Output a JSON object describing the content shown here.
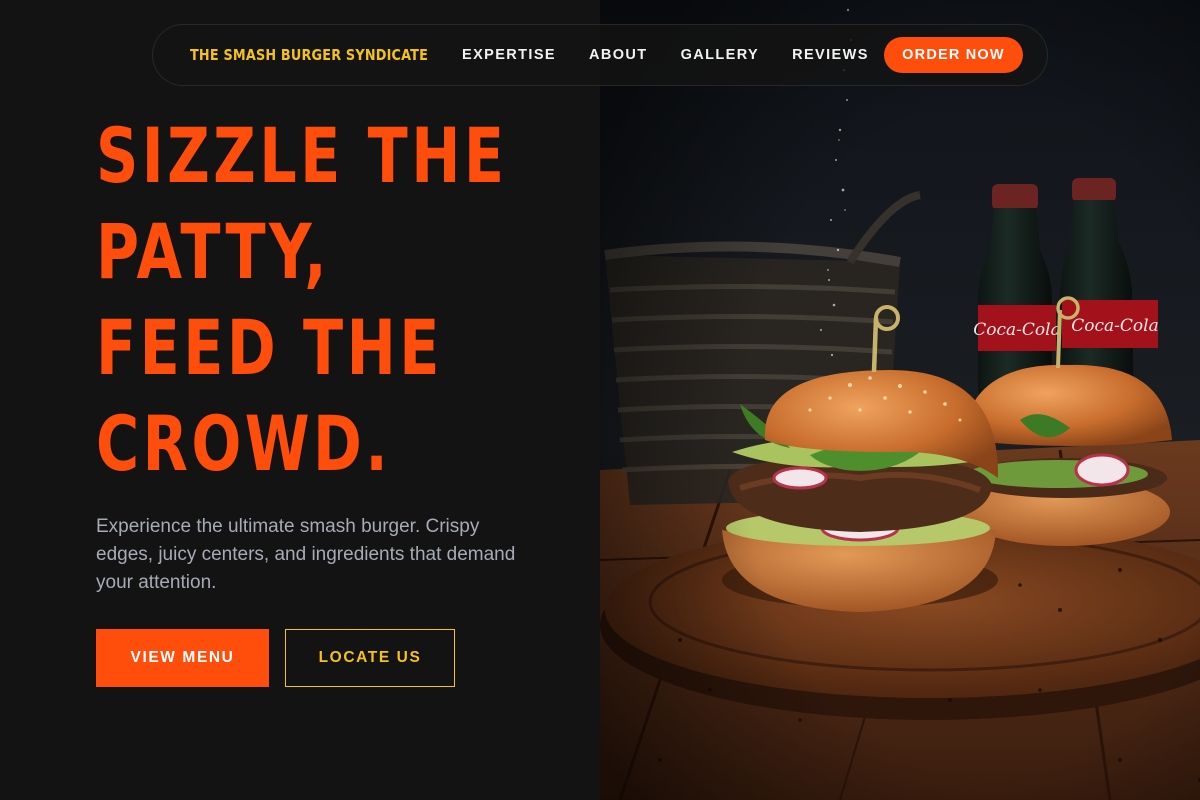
{
  "navbar": {
    "brand": "THE SMASH BURGER SYNDICATE",
    "links": [
      "EXPERTISE",
      "ABOUT",
      "GALLERY",
      "REVIEWS"
    ],
    "cta": "ORDER NOW"
  },
  "hero": {
    "headline_lines": [
      "SIZZLE THE",
      "PATTY,",
      "FEED THE",
      "CROWD."
    ],
    "subtext": "Experience the ultimate smash burger. Crispy edges, juicy centers, and ingredients that demand your attention.",
    "primary_button": "VIEW MENU",
    "secondary_button": "LOCATE US",
    "image": {
      "subject": "burger-photo",
      "bottle_label": "Coca-Cola"
    }
  },
  "colors": {
    "background": "#131313",
    "accent": "#ff4d0c",
    "brand_yellow": "#f5c21b",
    "muted_text": "#a6abb6"
  }
}
